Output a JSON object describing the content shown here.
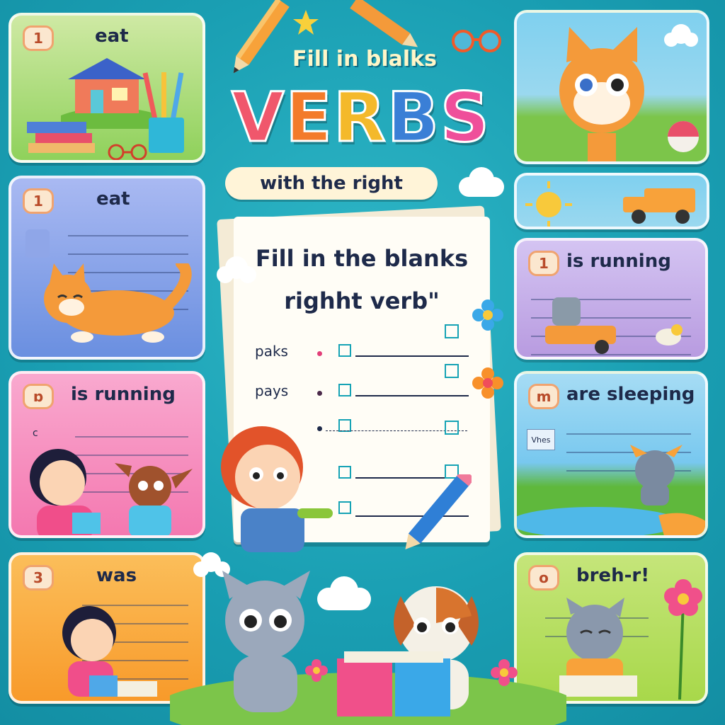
{
  "header": {
    "subtitle": "Fill in blalks",
    "title_letters": [
      {
        "ch": "V",
        "color": "#f0576c"
      },
      {
        "ch": "E",
        "color": "#f37b2a"
      },
      {
        "ch": "R",
        "color": "#f4b92b"
      },
      {
        "ch": "B",
        "color": "#3a7fd6"
      },
      {
        "ch": "S",
        "color": "#ef4f9a"
      }
    ],
    "ribbon": "with the right"
  },
  "worksheet": {
    "title_line1": "Fill in the blanks",
    "title_line2": "righht verb\"",
    "rows": [
      {
        "label": "paks",
        "dot_color": "#e23f79"
      },
      {
        "label": "pays",
        "dot_color": "#4b2a4a"
      },
      {
        "label": "",
        "dot_color": "#1e2a4a"
      }
    ]
  },
  "cards": {
    "left1": {
      "badge": "1",
      "word": "eat"
    },
    "left2": {
      "badge": "1",
      "word": "eat"
    },
    "left3": {
      "badge": "ɒ",
      "word": "is running",
      "tiny": "c"
    },
    "left4": {
      "badge": "3",
      "word": "was"
    },
    "right2": {
      "badge": "1",
      "word": "is  running"
    },
    "right3": {
      "badge": "m",
      "word": "are sleeping",
      "tag": "Vhes"
    },
    "right4": {
      "badge": "o",
      "word": "breh-r!"
    }
  },
  "colors": {
    "background": "#1a9fb3",
    "card_green": "#8fd15b",
    "card_blue": "#6a8fe0",
    "card_pink": "#f478b0",
    "card_orange": "#f89a2a",
    "card_purple": "#b89be0",
    "card_sky": "#78c8ef",
    "card_lime": "#a8d84a"
  }
}
